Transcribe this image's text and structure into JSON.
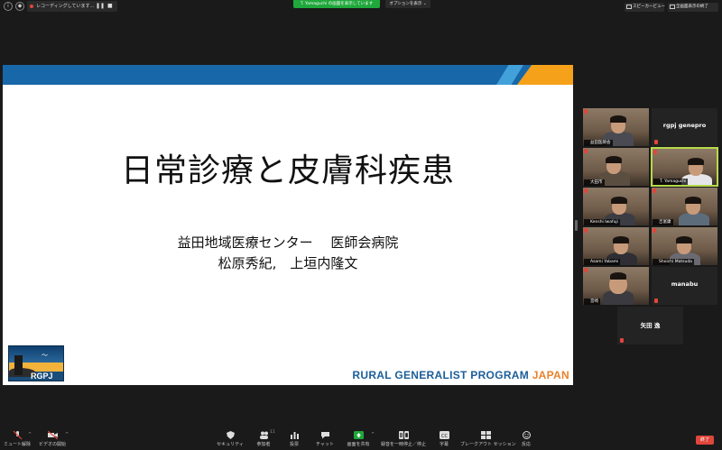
{
  "topbar": {
    "recording_text": "レコーディングしています...",
    "pause_glyph": "❚❚",
    "stop_glyph": "■",
    "share_banner": "T. Yamaguchi の画面を表示しています",
    "view_options": "オプションを表示 ⌄",
    "speaker_view": "スピーカービュー",
    "exit_fullscreen": "全画面表示の終了"
  },
  "slide": {
    "title": "日常診療と皮膚科疾患",
    "subtitle_line1": "益田地域医療センター　 医師会病院",
    "subtitle_line2": "松原秀紀,　上垣内隆文",
    "logo_text": "RGPJ",
    "program_main": "RURAL GENERALIST PROGRAM ",
    "program_accent": "JAPAN"
  },
  "participants": [
    {
      "name": "益田医師会",
      "video": true
    },
    {
      "name": "rgpj genepro",
      "video": false
    },
    {
      "name": "大田市",
      "video": true
    },
    {
      "name": "T. Yamaguchi",
      "video": true,
      "active": true
    },
    {
      "name": "Kenshi Iwafuji",
      "video": true
    },
    {
      "name": "吉富康",
      "video": true
    },
    {
      "name": "Asami Yabami",
      "video": true
    },
    {
      "name": "Shoichi Matsuda",
      "video": true
    },
    {
      "name": "宮崎",
      "video": true
    },
    {
      "name": "manabu",
      "video": false
    },
    {
      "name": "矢田 逸",
      "video": false
    }
  ],
  "toolbar": {
    "mute": "ミュート解除",
    "video": "ビデオの開始",
    "security": "セキュリティ",
    "participants": "参加者",
    "participants_count": "11",
    "polls": "投票",
    "chat": "チャット",
    "share": "画面を共有",
    "record": "録音を一時停止／停止",
    "captions": "字幕",
    "breakout": "ブレークアウト セッション",
    "reactions": "反応",
    "end": "終了"
  },
  "colors": {
    "share_green": "#1fa83b",
    "end_red": "#e0463c",
    "active_border": "#b6d94b",
    "slide_blue": "#1867a8",
    "slide_orange": "#f5a11a"
  }
}
